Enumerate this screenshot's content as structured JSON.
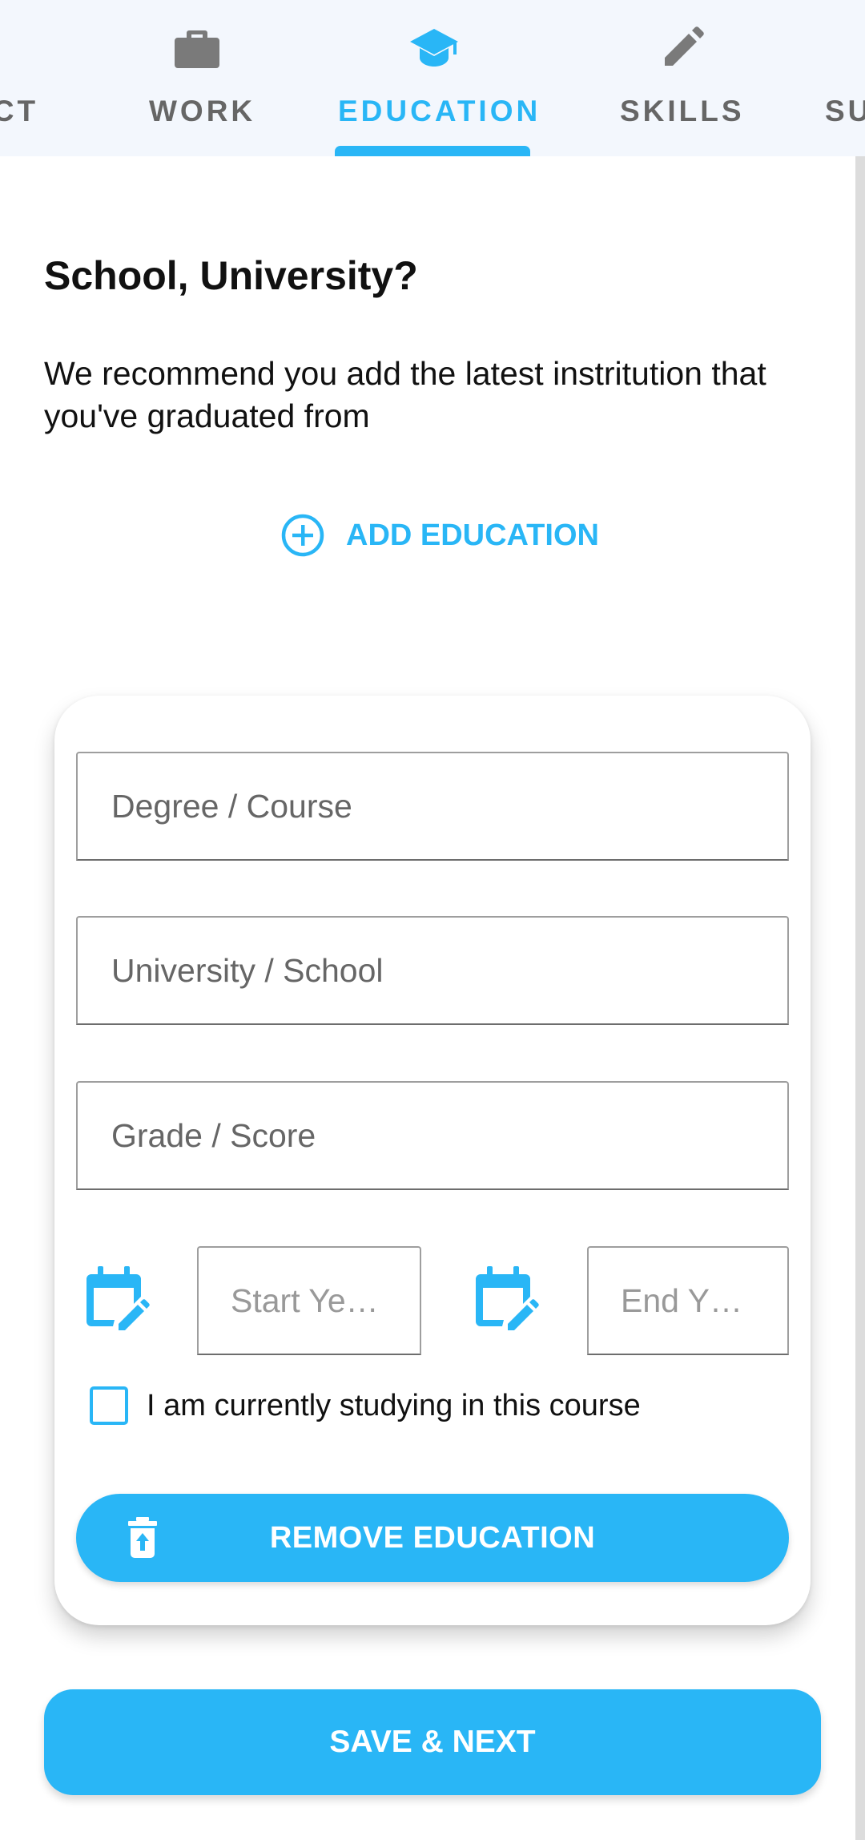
{
  "tabs": [
    {
      "label": "ACT",
      "icon": "contact-icon",
      "active": false
    },
    {
      "label": "WORK",
      "icon": "briefcase-icon",
      "active": false
    },
    {
      "label": "EDUCATION",
      "icon": "graduation-cap-icon",
      "active": true
    },
    {
      "label": "SKILLS",
      "icon": "pencil-icon",
      "active": false
    },
    {
      "label": "SU",
      "icon": "",
      "active": false
    }
  ],
  "section": {
    "title": "School, University?",
    "description": "We recommend you add the latest instritution that you've graduated from"
  },
  "add_education": {
    "label": "ADD EDUCATION",
    "icon": "add-circle-icon"
  },
  "education_form": {
    "degree": {
      "placeholder": "Degree / Course",
      "value": ""
    },
    "school": {
      "placeholder": "University / School",
      "value": ""
    },
    "grade": {
      "placeholder": "Grade / Score",
      "value": ""
    },
    "start_year": {
      "placeholder": "Start Ye…",
      "value": "",
      "icon": "calendar-edit-icon"
    },
    "end_year": {
      "placeholder": "End Y…",
      "value": "",
      "icon": "calendar-edit-icon"
    },
    "currently_studying": {
      "label": "I am currently studying in this course",
      "checked": false
    },
    "remove_button": {
      "label": "REMOVE EDUCATION",
      "icon": "trash-icon"
    }
  },
  "save_button": {
    "label": "SAVE & NEXT"
  },
  "colors": {
    "accent": "#29b6f6",
    "tabbar_bg": "#f3f7fd",
    "inactive_tab": "#666666"
  }
}
